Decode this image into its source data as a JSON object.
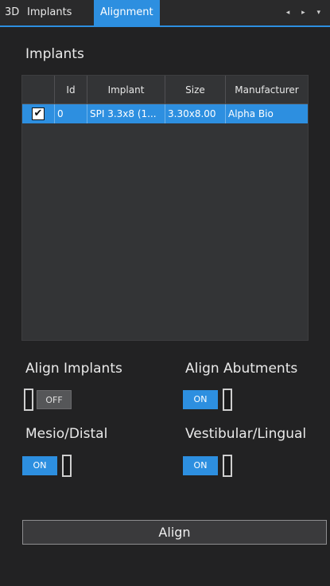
{
  "tabs": [
    {
      "label": "3D"
    },
    {
      "label": "Implants"
    },
    {
      "label": "Alignment"
    }
  ],
  "tab_arrows": "◂ ▸ ▾",
  "implants": {
    "title": "Implants",
    "columns": [
      "",
      "Id",
      "Implant",
      "Size",
      "Manufacturer"
    ],
    "rows": [
      {
        "checked": "✔",
        "id": "0",
        "implant": "SPI 3.3x8 (1...",
        "size": "3.30x8.00",
        "manufacturer": "Alpha Bio"
      }
    ]
  },
  "options": {
    "align_implants": {
      "label": "Align Implants",
      "state": "OFF"
    },
    "align_abutments": {
      "label": "Align Abutments",
      "state": "ON"
    },
    "mesio_distal": {
      "label": "Mesio/Distal",
      "state": "ON"
    },
    "vestibular_lingual": {
      "label": "Vestibular/Lingual",
      "state": "ON"
    }
  },
  "align_button": "Align",
  "colors": {
    "accent": "#2d8fe0",
    "background": "#222223"
  }
}
